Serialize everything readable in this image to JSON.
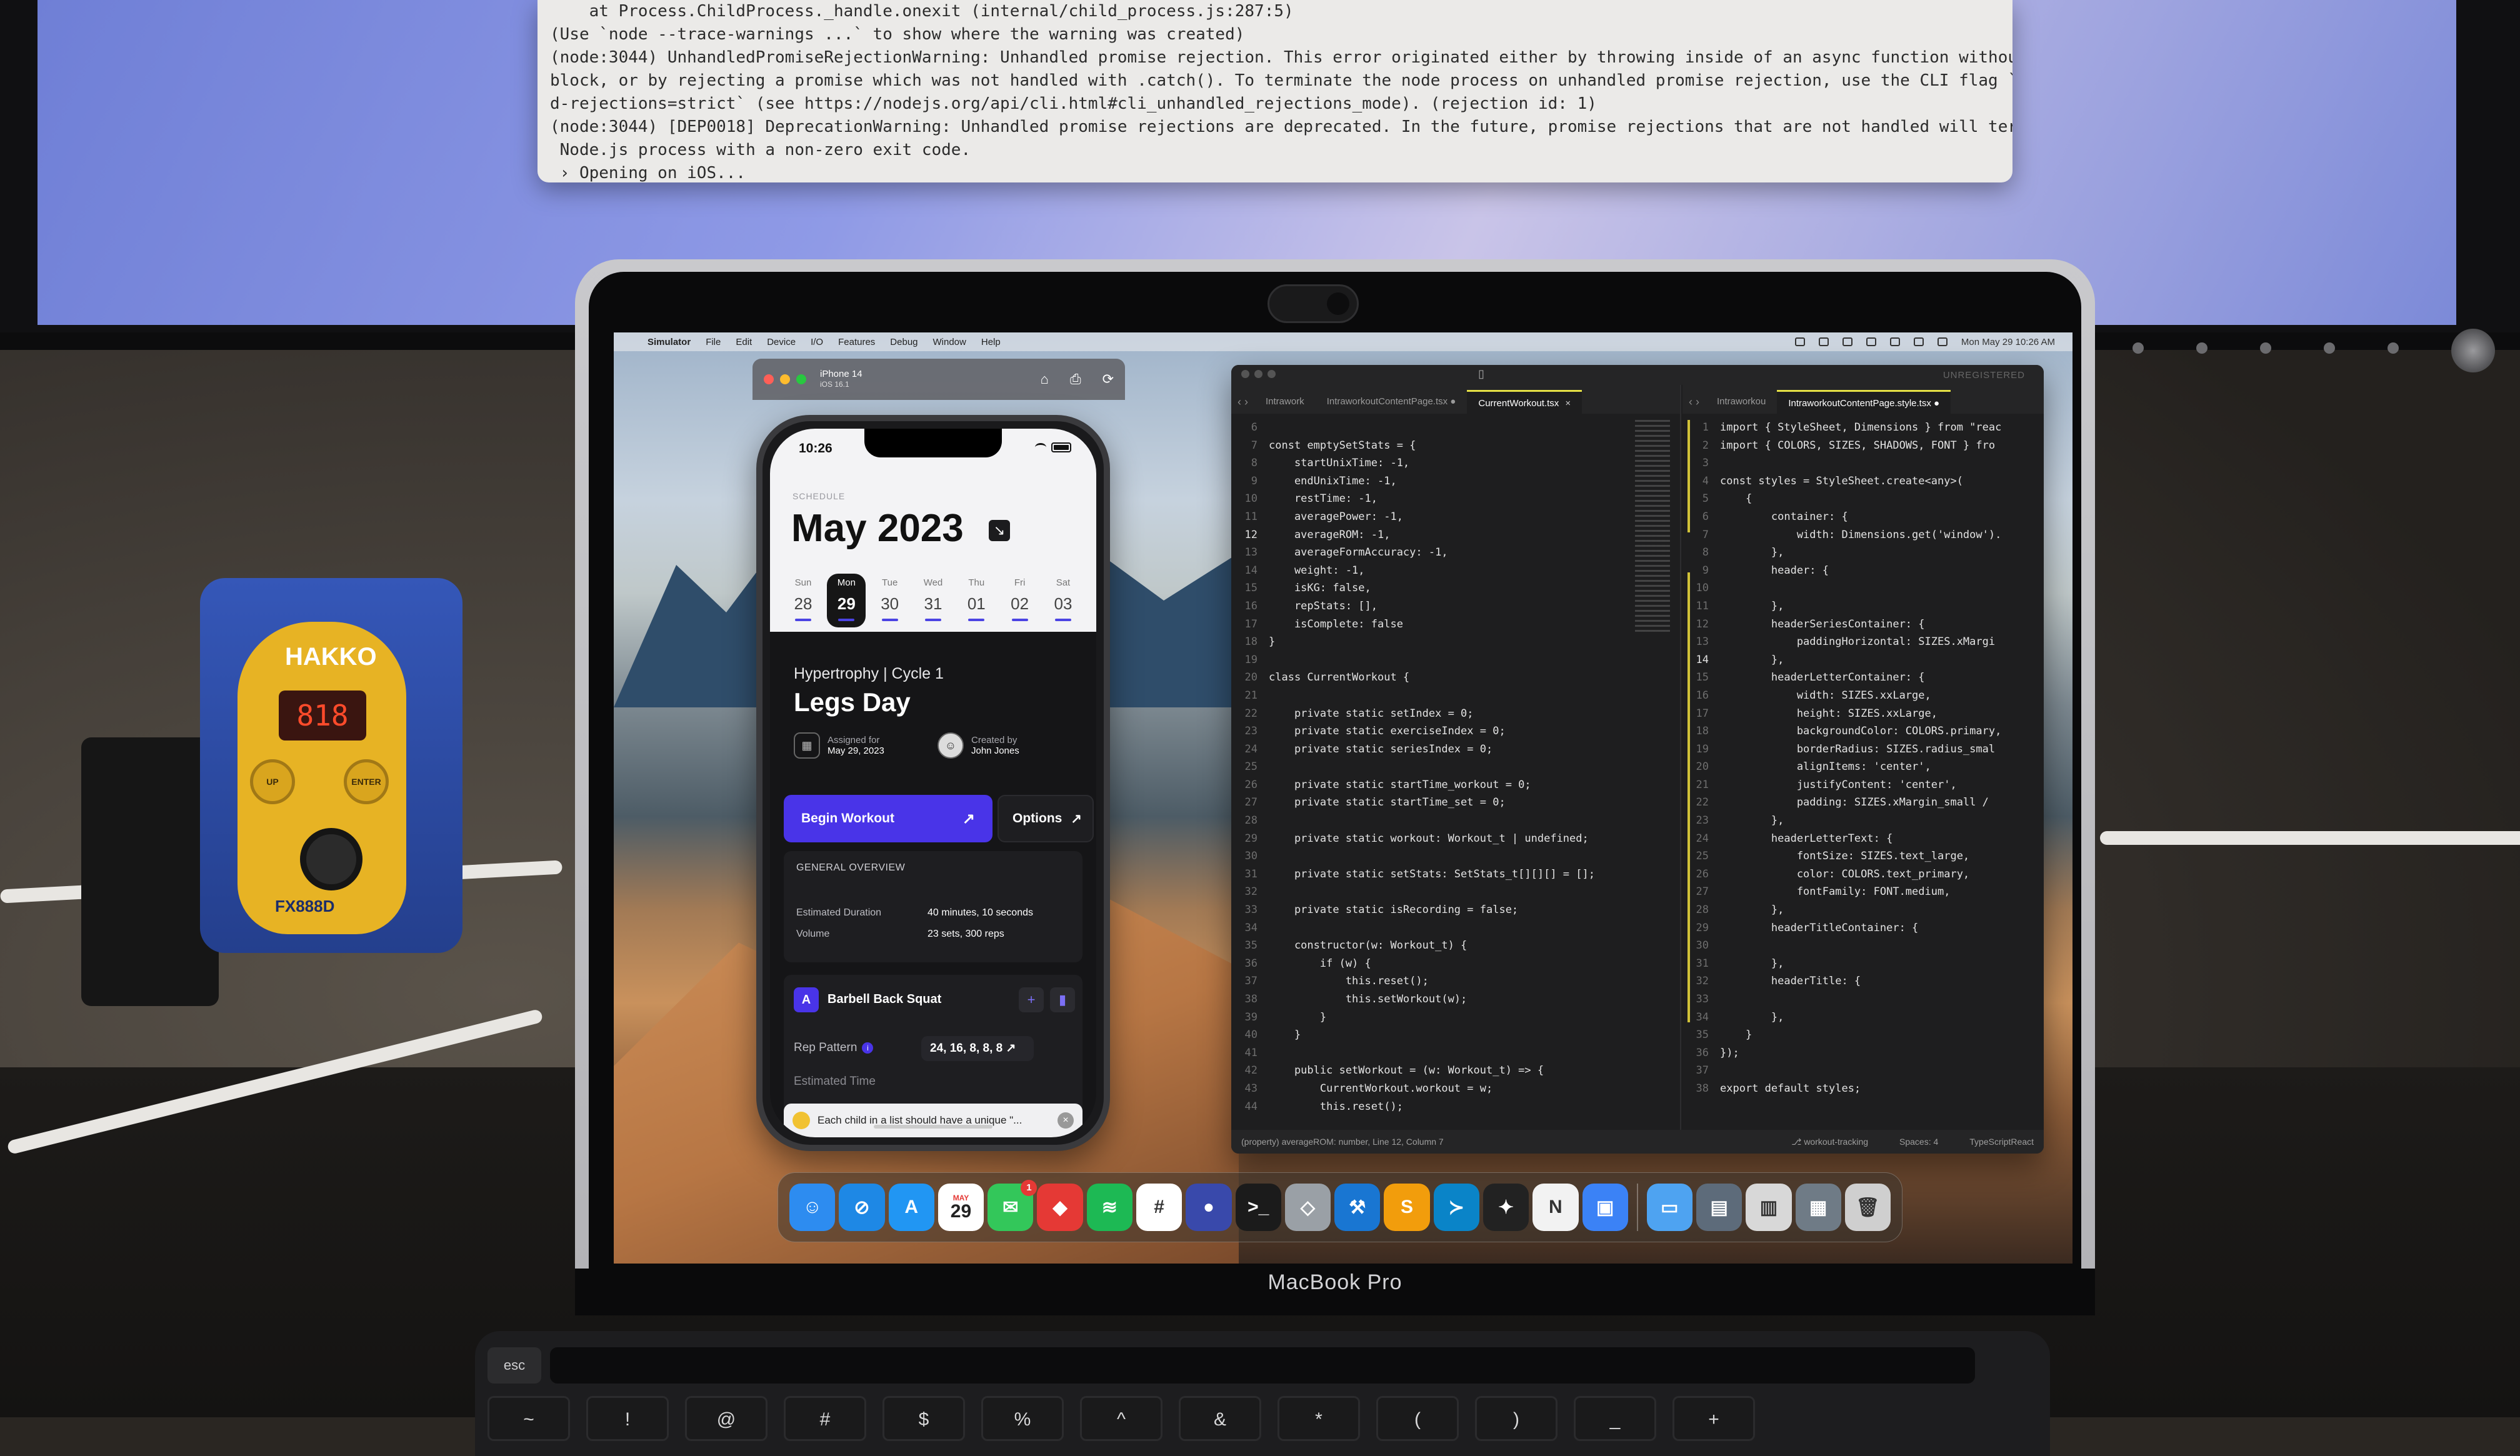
{
  "terminal": {
    "lines": [
      "    at Process.ChildProcess._handle.onexit (internal/child_process.js:287:5)",
      "(Use `node --trace-warnings ...` to show where the warning was created)",
      "(node:3044) UnhandledPromiseRejectionWarning: Unhandled promise rejection. This error originated either by throwing inside of an async function without a catch",
      "block, or by rejecting a promise which was not handled with .catch(). To terminate the node process on unhandled promise rejection, use the CLI flag `--unhandle",
      "d-rejections=strict` (see https://nodejs.org/api/cli.html#cli_unhandled_rejections_mode). (rejection id: 1)",
      "(node:3044) [DEP0018] DeprecationWarning: Unhandled promise rejections are deprecated. In the future, promise rejections that are not handled will terminate the",
      " Node.js process with a non-zero exit code.",
      " › Opening on iOS..."
    ]
  },
  "props": {
    "hakko_logo": "HAKKO",
    "hakko_display": "818",
    "hakko_up": "UP",
    "hakko_enter": "ENTER",
    "hakko_model": "FX888D"
  },
  "laptop": {
    "label": "MacBook Pro",
    "touchbar_esc": "esc",
    "key_row": [
      "~",
      "!",
      "@",
      "#",
      "$",
      "%",
      "^",
      "&",
      "*",
      "(",
      ")",
      "_",
      "+"
    ]
  },
  "menubar": {
    "apple": "",
    "app": "Simulator",
    "items": [
      "File",
      "Edit",
      "Device",
      "I/O",
      "Features",
      "Debug",
      "Window",
      "Help"
    ],
    "clock": "Mon May 29 10:26 AM"
  },
  "simulator": {
    "device": "iPhone 14",
    "os": "iOS 16.1",
    "actions": [
      "⌂",
      "⎙",
      "⟳"
    ]
  },
  "app": {
    "status_time": "10:26",
    "calendar": {
      "label": "SCHEDULE",
      "title": "May 2023",
      "days": [
        {
          "name": "Sun",
          "date": "28"
        },
        {
          "name": "Mon",
          "date": "29",
          "active": true
        },
        {
          "name": "Tue",
          "date": "30"
        },
        {
          "name": "Wed",
          "date": "31"
        },
        {
          "name": "Thu",
          "date": "01"
        },
        {
          "name": "Fri",
          "date": "02"
        },
        {
          "name": "Sat",
          "date": "03"
        }
      ]
    },
    "workout": {
      "subtitle": "Hypertrophy | Cycle 1",
      "title": "Legs Day",
      "assigned_label": "Assigned for",
      "assigned_value": "May 29, 2023",
      "created_label": "Created by",
      "created_value": "John Jones"
    },
    "begin_label": "Begin Workout",
    "options_label": "Options",
    "overview": {
      "title": "GENERAL OVERVIEW",
      "duration_label": "Estimated Duration",
      "duration_value": "40 minutes, 10 seconds",
      "volume_label": "Volume",
      "volume_value": "23 sets, 300 reps"
    },
    "exercise": {
      "badge": "A",
      "name": "Barbell Back Squat",
      "rep_label": "Rep Pattern",
      "rep_value": "24, 16, 8, 8, 8",
      "time_label": "Estimated Time"
    },
    "toast": "Each child in a list should have a unique \"..."
  },
  "vscode": {
    "unregistered": "UNREGISTERED",
    "left_tabs": [
      "IntraworkoutContentPage.tsx",
      "CurrentWorkout.tsx"
    ],
    "left_tab_short": "Intrawork",
    "right_tabs": [
      "IntraworkoutContentPage.style.tsx"
    ],
    "right_tab_short": "Intraworkou",
    "left_code": [
      {
        "n": "6",
        "t": ""
      },
      {
        "n": "7",
        "t": "const emptySetStats = {"
      },
      {
        "n": "8",
        "t": "    startUnixTime: -1,"
      },
      {
        "n": "9",
        "t": "    endUnixTime: -1,"
      },
      {
        "n": "10",
        "t": "    restTime: -1,"
      },
      {
        "n": "11",
        "t": "    averagePower: -1,"
      },
      {
        "n": "12",
        "t": "    averageROM: -1,"
      },
      {
        "n": "13",
        "t": "    averageFormAccuracy: -1,"
      },
      {
        "n": "14",
        "t": "    weight: -1,"
      },
      {
        "n": "15",
        "t": "    isKG: false,"
      },
      {
        "n": "16",
        "t": "    repStats: [],"
      },
      {
        "n": "17",
        "t": "    isComplete: false"
      },
      {
        "n": "18",
        "t": "}"
      },
      {
        "n": "19",
        "t": ""
      },
      {
        "n": "20",
        "t": "class CurrentWorkout {"
      },
      {
        "n": "21",
        "t": ""
      },
      {
        "n": "22",
        "t": "    private static setIndex = 0;"
      },
      {
        "n": "23",
        "t": "    private static exerciseIndex = 0;"
      },
      {
        "n": "24",
        "t": "    private static seriesIndex = 0;"
      },
      {
        "n": "25",
        "t": ""
      },
      {
        "n": "26",
        "t": "    private static startTime_workout = 0;"
      },
      {
        "n": "27",
        "t": "    private static startTime_set = 0;"
      },
      {
        "n": "28",
        "t": ""
      },
      {
        "n": "29",
        "t": "    private static workout: Workout_t | undefined;"
      },
      {
        "n": "30",
        "t": ""
      },
      {
        "n": "31",
        "t": "    private static setStats: SetStats_t[][][] = [];"
      },
      {
        "n": "32",
        "t": ""
      },
      {
        "n": "33",
        "t": "    private static isRecording = false;"
      },
      {
        "n": "34",
        "t": ""
      },
      {
        "n": "35",
        "t": "    constructor(w: Workout_t) {"
      },
      {
        "n": "36",
        "t": "        if (w) {"
      },
      {
        "n": "37",
        "t": "            this.reset();"
      },
      {
        "n": "38",
        "t": "            this.setWorkout(w);"
      },
      {
        "n": "39",
        "t": "        }"
      },
      {
        "n": "40",
        "t": "    }"
      },
      {
        "n": "41",
        "t": ""
      },
      {
        "n": "42",
        "t": "    public setWorkout = (w: Workout_t) => {"
      },
      {
        "n": "43",
        "t": "        CurrentWorkout.workout = w;"
      },
      {
        "n": "44",
        "t": "        this.reset();"
      }
    ],
    "right_code": [
      {
        "n": "1",
        "t": "import { StyleSheet, Dimensions } from \"reac"
      },
      {
        "n": "2",
        "t": "import { COLORS, SIZES, SHADOWS, FONT } fro"
      },
      {
        "n": "3",
        "t": ""
      },
      {
        "n": "4",
        "t": "const styles = StyleSheet.create<any>("
      },
      {
        "n": "5",
        "t": "    {"
      },
      {
        "n": "6",
        "t": "        container: {"
      },
      {
        "n": "7",
        "t": "            width: Dimensions.get('window')."
      },
      {
        "n": "8",
        "t": "        },"
      },
      {
        "n": "9",
        "t": "        header: {"
      },
      {
        "n": "10",
        "t": ""
      },
      {
        "n": "11",
        "t": "        },"
      },
      {
        "n": "12",
        "t": "        headerSeriesContainer: {"
      },
      {
        "n": "13",
        "t": "            paddingHorizontal: SIZES.xMargi"
      },
      {
        "n": "14",
        "t": "        },"
      },
      {
        "n": "15",
        "t": "        headerLetterContainer: {"
      },
      {
        "n": "16",
        "t": "            width: SIZES.xxLarge,"
      },
      {
        "n": "17",
        "t": "            height: SIZES.xxLarge,"
      },
      {
        "n": "18",
        "t": "            backgroundColor: COLORS.primary,"
      },
      {
        "n": "19",
        "t": "            borderRadius: SIZES.radius_smal"
      },
      {
        "n": "20",
        "t": "            alignItems: 'center',"
      },
      {
        "n": "21",
        "t": "            justifyContent: 'center',"
      },
      {
        "n": "22",
        "t": "            padding: SIZES.xMargin_small /"
      },
      {
        "n": "23",
        "t": "        },"
      },
      {
        "n": "24",
        "t": "        headerLetterText: {"
      },
      {
        "n": "25",
        "t": "            fontSize: SIZES.text_large,"
      },
      {
        "n": "26",
        "t": "            color: COLORS.text_primary,"
      },
      {
        "n": "27",
        "t": "            fontFamily: FONT.medium,"
      },
      {
        "n": "28",
        "t": "        },"
      },
      {
        "n": "29",
        "t": "        headerTitleContainer: {"
      },
      {
        "n": "30",
        "t": ""
      },
      {
        "n": "31",
        "t": "        },"
      },
      {
        "n": "32",
        "t": "        headerTitle: {"
      },
      {
        "n": "33",
        "t": ""
      },
      {
        "n": "34",
        "t": "        },"
      },
      {
        "n": "35",
        "t": "    }"
      },
      {
        "n": "36",
        "t": "});"
      },
      {
        "n": "37",
        "t": ""
      },
      {
        "n": "38",
        "t": "export default styles;"
      }
    ],
    "status_left": "(property) averageROM: number, Line 12, Column 7",
    "status_branch": "workout-tracking",
    "status_spaces": "Spaces: 4",
    "status_lang": "TypeScriptReact"
  },
  "dock": {
    "calendar_month": "MAY",
    "calendar_day": "29",
    "messages_badge": "1",
    "icons": [
      {
        "name": "finder-icon",
        "color": "#2d8cf0",
        "glyph": "☺"
      },
      {
        "name": "safari-icon",
        "color": "#1e88e5",
        "glyph": "⊘"
      },
      {
        "name": "app-store-icon",
        "color": "#2196f3",
        "glyph": "A"
      },
      {
        "name": "calendar-icon",
        "color": "#ffffff",
        "glyph": ""
      },
      {
        "name": "messages-icon",
        "color": "#33c75a",
        "glyph": "✉"
      },
      {
        "name": "red-app-icon",
        "color": "#e53935",
        "glyph": "◆"
      },
      {
        "name": "spotify-icon",
        "color": "#1db954",
        "glyph": "≋"
      },
      {
        "name": "slack-icon",
        "color": "#ffffff",
        "glyph": "#"
      },
      {
        "name": "blue-app-icon",
        "color": "#3949ab",
        "glyph": "●"
      },
      {
        "name": "terminal-icon",
        "color": "#1b1b1b",
        "glyph": ">_"
      },
      {
        "name": "silver-app-icon",
        "color": "#9aa0a6",
        "glyph": "◇"
      },
      {
        "name": "xcode-icon",
        "color": "#1976d2",
        "glyph": "⚒"
      },
      {
        "name": "sublime-icon",
        "color": "#f29d0c",
        "glyph": "S"
      },
      {
        "name": "vscode-icon",
        "color": "#0a84c8",
        "glyph": "≻"
      },
      {
        "name": "figma-icon",
        "color": "#222222",
        "glyph": "✦"
      },
      {
        "name": "notion-icon",
        "color": "#f2f2f2",
        "glyph": "N"
      },
      {
        "name": "simulator-icon",
        "color": "#3b82f6",
        "glyph": "▣"
      }
    ],
    "right_icons": [
      {
        "name": "folder-icon",
        "color": "#4ea3f1",
        "glyph": "▭"
      },
      {
        "name": "downloads-stack-icon",
        "color": "#5d6b7a",
        "glyph": "▤"
      },
      {
        "name": "documents-stack-icon",
        "color": "#d8d8d8",
        "glyph": "▥"
      },
      {
        "name": "screenshots-stack-icon",
        "color": "#6f7b86",
        "glyph": "▦"
      },
      {
        "name": "trash-icon",
        "color": "#cfcfcf",
        "glyph": "🗑"
      }
    ]
  }
}
